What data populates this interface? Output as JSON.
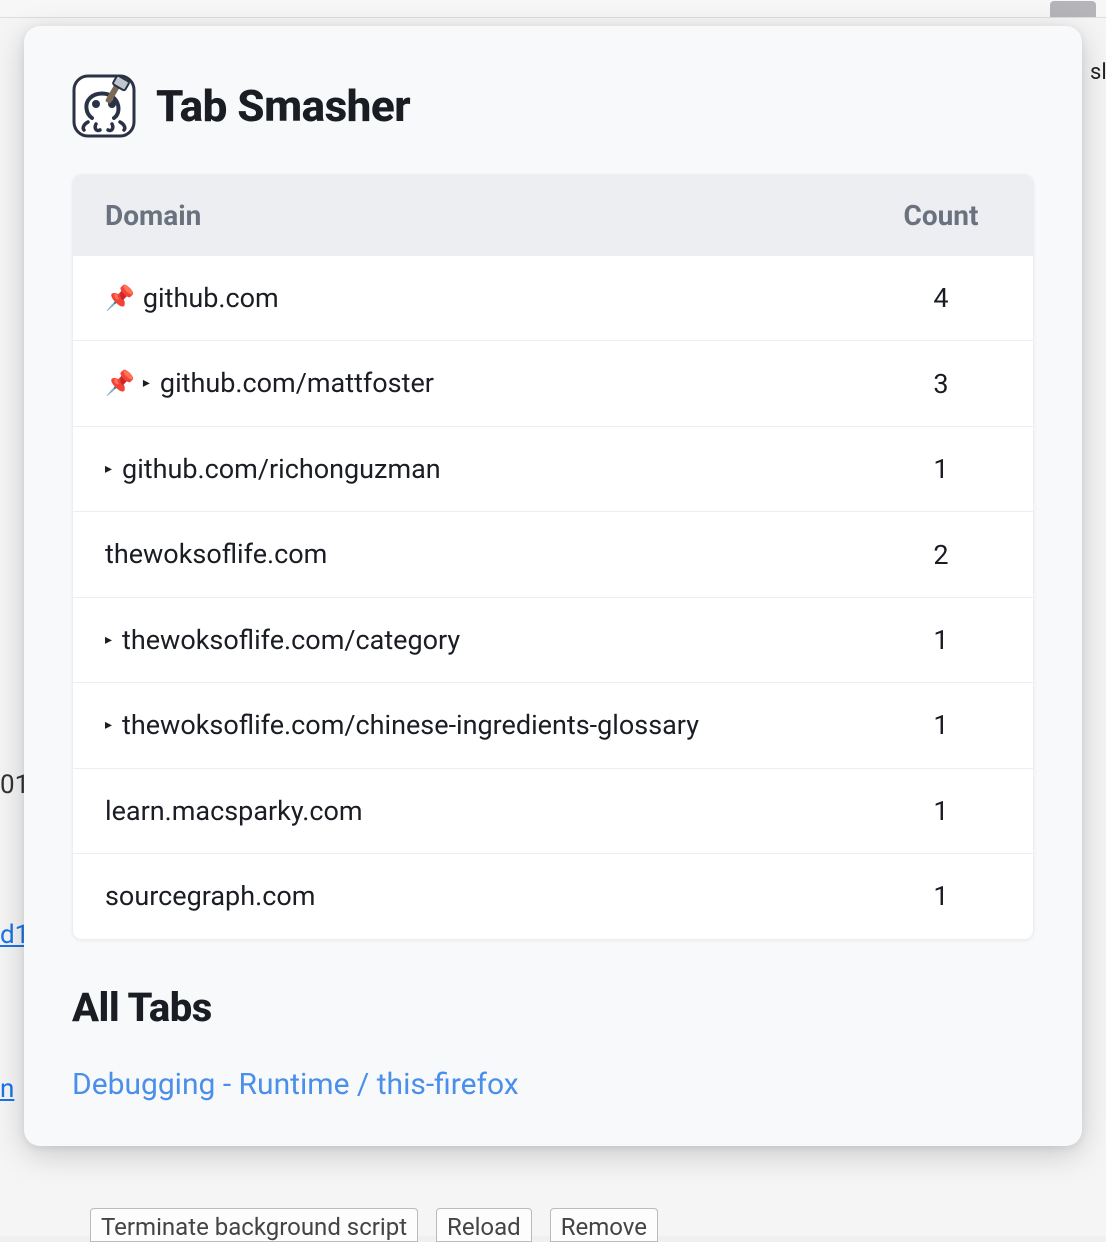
{
  "app": {
    "title": "Tab Smasher"
  },
  "table": {
    "headers": {
      "domain": "Domain",
      "count": "Count"
    },
    "rows": [
      {
        "pinned": true,
        "caret": false,
        "label": "github.com",
        "count": "4"
      },
      {
        "pinned": true,
        "caret": true,
        "label": "github.com/mattfoster",
        "count": "3"
      },
      {
        "pinned": false,
        "caret": true,
        "label": "github.com/richonguzman",
        "count": "1"
      },
      {
        "pinned": false,
        "caret": false,
        "label": "thewoksoflife.com",
        "count": "2"
      },
      {
        "pinned": false,
        "caret": true,
        "label": "thewoksoflife.com/category",
        "count": "1"
      },
      {
        "pinned": false,
        "caret": true,
        "label": "thewoksoflife.com/chinese-ingredients-glossary",
        "count": "1"
      },
      {
        "pinned": false,
        "caret": false,
        "label": "learn.macsparky.com",
        "count": "1"
      },
      {
        "pinned": false,
        "caret": false,
        "label": "sourcegraph.com",
        "count": "1"
      }
    ]
  },
  "all_tabs": {
    "heading": "All Tabs",
    "items": [
      {
        "title": "Debugging - Runtime / this-firefox"
      }
    ]
  },
  "backdrop": {
    "fragment_01": "01",
    "fragment_d1": "d1",
    "fragment_n": "n",
    "fragment_sl": "sl",
    "buttons": {
      "terminate": "Terminate background script",
      "reload": "Reload",
      "remove": "Remove"
    }
  }
}
